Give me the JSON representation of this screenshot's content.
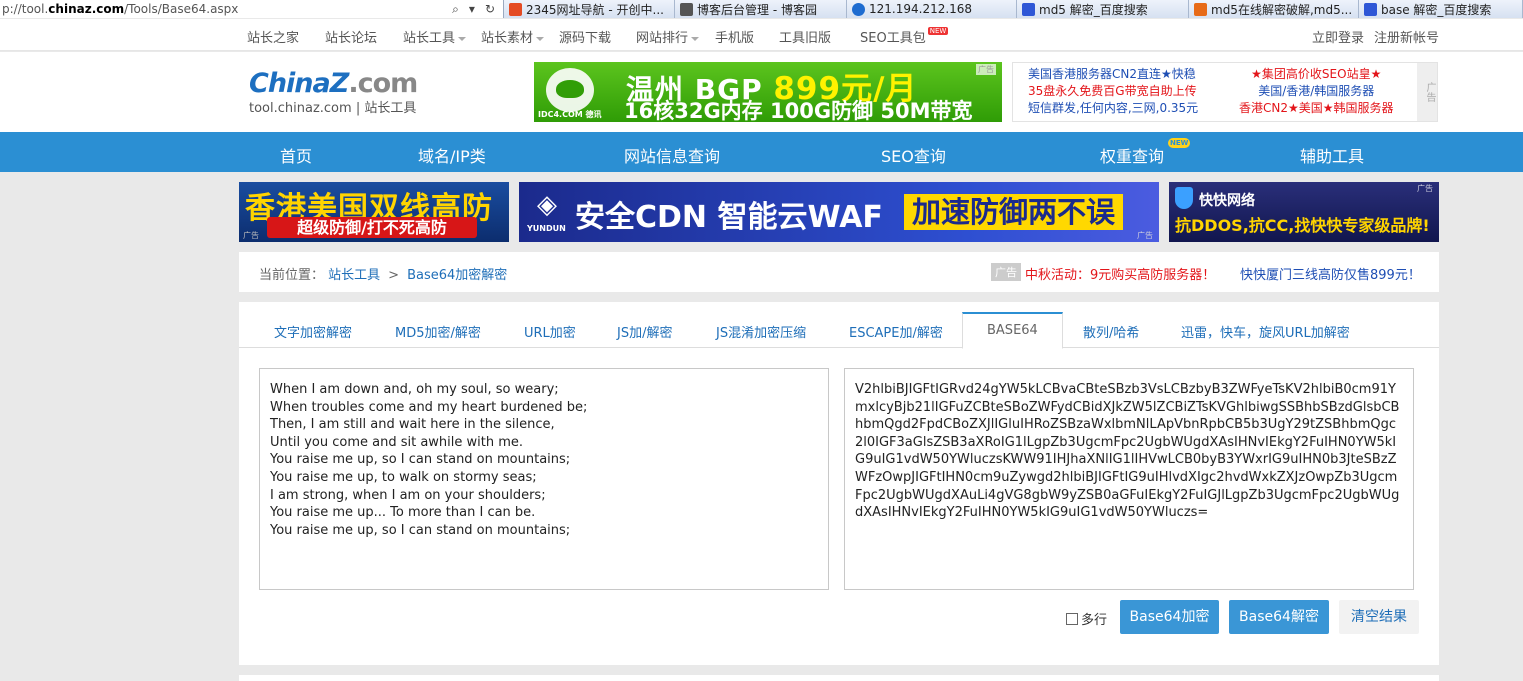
{
  "browser": {
    "url_prefix": "p://tool.",
    "url_domain": "chinaz.com",
    "url_path": "/Tools/Base64.aspx",
    "tabs": [
      {
        "label": "2345网址导航 - 开创中...",
        "color": "#e44b23"
      },
      {
        "label": "博客后台管理 - 博客园",
        "color": "#555555"
      },
      {
        "label": "121.194.212.168",
        "color": "#1e6cd0"
      },
      {
        "label": "md5 解密_百度搜索",
        "color": "#2f57d6"
      },
      {
        "label": "md5在线解密破解,md5...",
        "color": "#e76a17"
      },
      {
        "label": "base 解密_百度搜索",
        "color": "#2f57d6"
      }
    ]
  },
  "topnav": {
    "items": [
      "站长之家",
      "站长论坛",
      "站长工具",
      "站长素材",
      "源码下载",
      "网站排行",
      "手机版",
      "工具旧版",
      "SEO工具包"
    ],
    "new_badge": "NEW",
    "login": "立即登录",
    "register": "注册新帐号"
  },
  "logo": {
    "brand": "China",
    "brand_z": "Z",
    "brand_suffix": ".com",
    "subtitle_domain": "tool.chinaz.com",
    "subtitle_name": "站长工具"
  },
  "ads": {
    "bgp": {
      "line1": "温州 BGP",
      "price": "899元/月",
      "line2": "16核32G内存 100G防御 50M带宽",
      "brand": "IDC4.COM 德讯",
      "tag": "广告"
    },
    "text": {
      "col1": [
        "美国香港服务器CN2直连★快稳",
        "35盘永久免费百G带宽自助上传",
        "短信群发,任何内容,三网,0.35元"
      ],
      "col2": [
        "★集团高价收SEO站皇★",
        "美国/香港/韩国服务器",
        "香港CN2★美国★韩国服务器"
      ],
      "side": "广告"
    },
    "banner1": {
      "line1": "香港美国双线高防",
      "line2": "超级防御/打不死高防",
      "tag": "广告"
    },
    "banner2": {
      "brand": "YUNDUN",
      "line1": "安全CDN 智能云WAF",
      "line2": "加速防御两不误",
      "tag": "广告"
    },
    "banner3": {
      "title": "快快网络",
      "line2_a": "抗DDOS,抗CC,",
      "line2_b": "找快快专家级品牌!",
      "tag": "广告"
    }
  },
  "mainnav": {
    "items": [
      "首页",
      "域名/IP类",
      "网站信息查询",
      "SEO查询",
      "权重查询",
      "辅助工具"
    ],
    "new_badge": "NEW"
  },
  "breadcrumb": {
    "label": "当前位置：",
    "root": "站长工具",
    "separator": ">",
    "current": "Base64加密解密",
    "ad_tag": "广告",
    "promo1": "中秋活动：9元购买高防服务器！",
    "promo2": "快快厦门三线高防仅售899元！"
  },
  "tabs": {
    "items": [
      "文字加密解密",
      "MD5加密/解密",
      "URL加密",
      "JS加/解密",
      "JS混淆加密压缩",
      "ESCAPE加/解密",
      "BASE64",
      "散列/哈希",
      "迅雷，快车，旋风URL加解密"
    ],
    "active_index": 6
  },
  "editor": {
    "input_text": "When I am down and, oh my soul, so weary;\nWhen troubles come and my heart burdened be;\nThen, I am still and wait here in the silence,\nUntil you come and sit awhile with me.\nYou raise me up, so I can stand on mountains;\nYou raise me up, to walk on stormy seas;\nI am strong, when I am on your shoulders;\nYou raise me up... To more than I can be.\nYou raise me up, so I can stand on mountains;",
    "output_text": "V2hlbiBJIGFtIGRvd24gYW5kLCBvaCBteSBzb3VsLCBzbyB3ZWFyeTsKV2hlbiB0cm91YmxlcyBjb21lIGFuZCBteSBoZWFydCBidXJkZW5lZCBiZTsKVGhlbiwgSSBhbSBzdGlsbCBhbmQgd2FpdCBoZXJlIGluIHRoZSBzaWxlbmNlLApVbnRpbCB5b3UgY29tZSBhbmQgc2l0IGF3aGlsZSB3aXRoIG1lLgpZb3UgcmFpc2UgbWUgdXAsIHNvIEkgY2FuIHN0YW5kIG9uIG1vdW50YWluczsKWW91IHJhaXNlIG1lIHVwLCB0byB3YWxrIG9uIHN0b3JteSBzZWFzOwpJIGFtIHN0cm9uZywgd2hlbiBJIGFtIG9uIHlvdXIgc2hvdWxkZXJzOwpZb3UgcmFpc2UgbWUgdXAuLi4gVG8gbW9yZSB0aGFuIEkgY2FuIGJlLgpZb3UgcmFpc2UgbWUgdXAsIHNvIEkgY2FuIHN0YW5kIG9uIG1vdW50YWluczs=",
    "multiline_label": "多行",
    "encode_button": "Base64加密",
    "decode_button": "Base64解密",
    "clear_button": "清空结果"
  },
  "colors": {
    "nav_blue": "#2b8fd3",
    "link_blue": "#1e6eb8",
    "button_blue": "#3a96d6",
    "promo_red": "#e3151a"
  }
}
